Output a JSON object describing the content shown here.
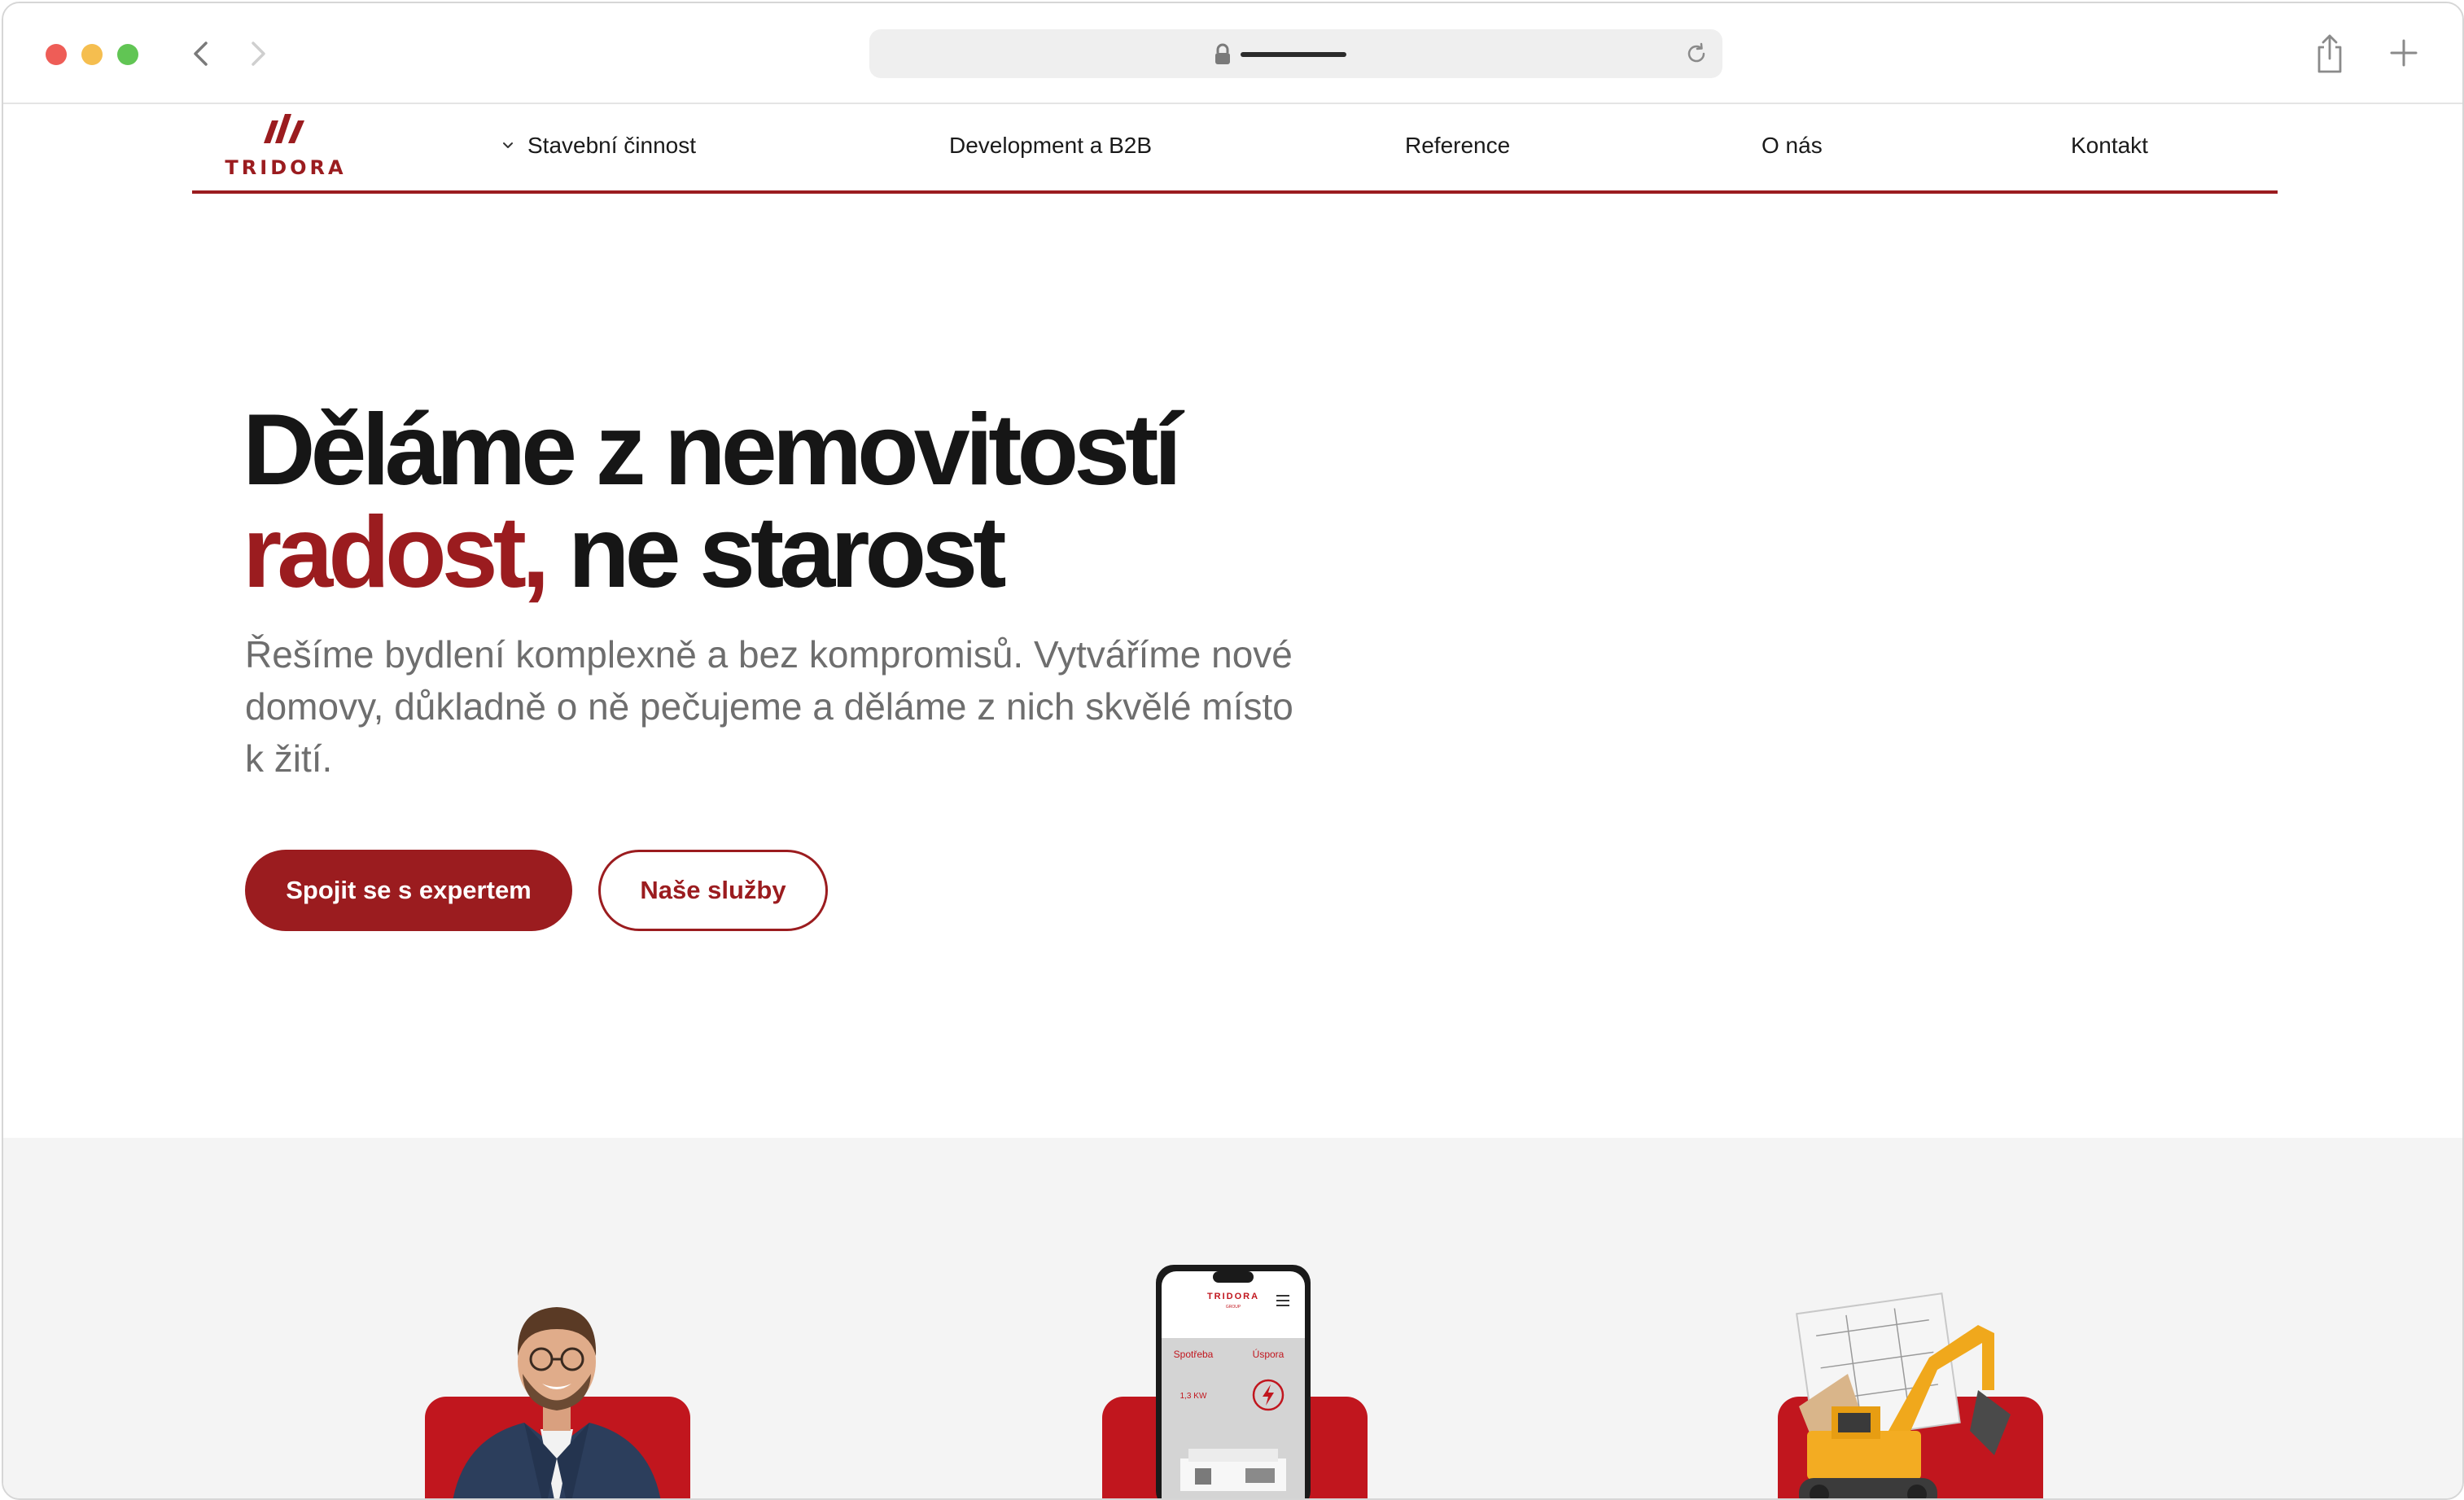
{
  "browser": {
    "traffic_lights": [
      "close",
      "minimize",
      "zoom"
    ],
    "icons": [
      "back-icon",
      "forward-icon",
      "lock-icon",
      "reload-icon",
      "share-icon",
      "new-tab-icon"
    ]
  },
  "header": {
    "logo_text": "TRIDORA",
    "nav": [
      {
        "label": "Stavební činnost",
        "has_dropdown": true
      },
      {
        "label": "Development a B2B"
      },
      {
        "label": "Reference"
      },
      {
        "label": "O nás"
      },
      {
        "label": "Kontakt"
      }
    ]
  },
  "hero": {
    "title_line1": "Děláme z nemovitostí",
    "title_accent": "radost,",
    "title_line2_rest": " ne starost",
    "subtitle": "Řešíme bydlení komplexně a bez kompromisů. Vytváříme nové domovy, důkladně o ně pečujeme a děláme z nich skvělé místo k žití.",
    "primary_button": "Spojit se s expertem",
    "secondary_button": "Naše služby"
  },
  "services": {
    "cards": [
      {
        "illustration": "smiling-man-photo"
      },
      {
        "illustration": "phone-app-mockup",
        "phone": {
          "brand": "TRIDORA",
          "brand_sub": "GROUP",
          "label_left": "Spotřeba",
          "label_right": "Úspora",
          "value_left": "1,3 KW"
        }
      },
      {
        "illustration": "excavator-with-blueprints"
      }
    ]
  },
  "colors": {
    "brand": "#9b1c1f",
    "card_red": "#c1161e",
    "band_bg": "#f4f4f4",
    "text_dark": "#161616",
    "text_muted": "#6e6e6e"
  }
}
